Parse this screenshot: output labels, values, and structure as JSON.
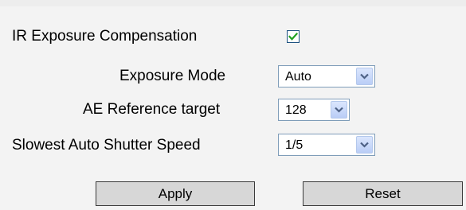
{
  "form": {
    "ir_compensation": {
      "label": "IR Exposure Compensation",
      "checked": true
    },
    "exposure_mode": {
      "label": "Exposure Mode",
      "value": "Auto"
    },
    "ae_reference": {
      "label": "AE Reference target",
      "value": "128"
    },
    "slowest_shutter": {
      "label": "Slowest Auto Shutter Speed",
      "value": "1/5"
    }
  },
  "buttons": {
    "apply_label": "Apply",
    "reset_label": "Reset"
  },
  "icons": {
    "checkbox": "checkmark-icon",
    "dropdown": "chevron-down-icon"
  },
  "colors": {
    "check": "#21a121",
    "select_border": "#7f9db9",
    "arrow_button": "#c6d7f9"
  }
}
